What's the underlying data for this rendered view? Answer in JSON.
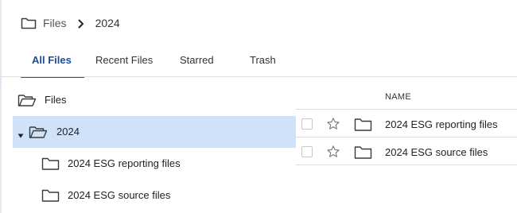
{
  "breadcrumb": {
    "root_icon": "folder-icon",
    "root": "Files",
    "separator_icon": "chevron-right-icon",
    "current": "2024"
  },
  "tabs": [
    {
      "label": "All Files",
      "active": true
    },
    {
      "label": "Recent Files",
      "active": false
    },
    {
      "label": "Starred",
      "active": false
    },
    {
      "label": "Trash",
      "active": false
    }
  ],
  "tree": {
    "root": {
      "label": "Files",
      "icon": "folder-open-icon"
    },
    "selected": {
      "label": "2024",
      "icon": "folder-open-icon",
      "expanded": true,
      "caret_icon": "caret-down-icon"
    },
    "children": [
      {
        "label": "2024 ESG reporting files",
        "icon": "folder-icon"
      },
      {
        "label": "2024 ESG source files",
        "icon": "folder-icon"
      }
    ]
  },
  "table": {
    "columns": {
      "name": "NAME"
    },
    "rows": [
      {
        "name": "2024 ESG reporting files",
        "checked": false,
        "starred": false,
        "icon": "folder-icon"
      },
      {
        "name": "2024 ESG source files",
        "checked": false,
        "starred": false,
        "icon": "folder-icon"
      }
    ]
  },
  "colors": {
    "accent": "#1f5aa6",
    "selected_row": "#cfe2fa",
    "divider": "#dddddd"
  }
}
